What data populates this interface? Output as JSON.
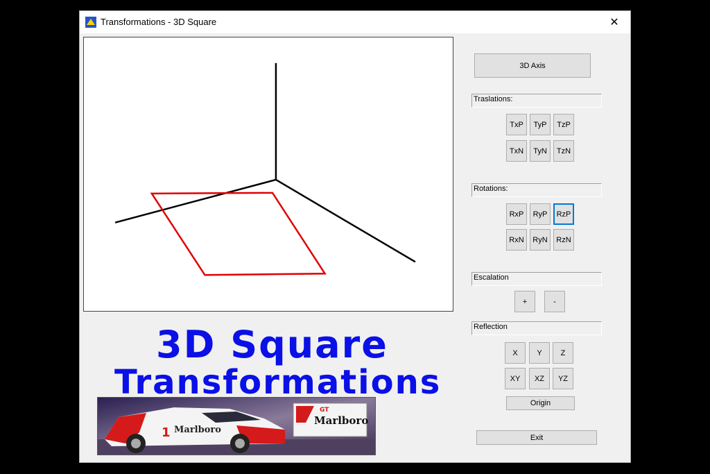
{
  "window": {
    "title": "Transformations - 3D Square",
    "close_glyph": "✕"
  },
  "buttons": {
    "axis": "3D Axis",
    "translations": [
      "TxP",
      "TyP",
      "TzP",
      "TxN",
      "TyN",
      "TzN"
    ],
    "rotations": [
      "RxP",
      "RyP",
      "RzP",
      "RxN",
      "RyN",
      "RzN"
    ],
    "scale": [
      "+",
      "-"
    ],
    "reflection": [
      "X",
      "Y",
      "Z",
      "XY",
      "XZ",
      "YZ"
    ],
    "origin": "Origin",
    "exit": "Exit"
  },
  "groups": {
    "translations": "Traslations:",
    "rotations": "Rotations:",
    "scale": "Escalation",
    "reflection": "Reflection"
  },
  "banner": {
    "line1": "3D Square",
    "line2": "Transformations"
  },
  "logo": {
    "brand_text": "Marlboro",
    "car_number": "1",
    "gt_text": "GT"
  },
  "colors": {
    "square": "#e00000",
    "axis": "#000000",
    "banner": "#0a10e6",
    "focus": "#0078d7"
  }
}
